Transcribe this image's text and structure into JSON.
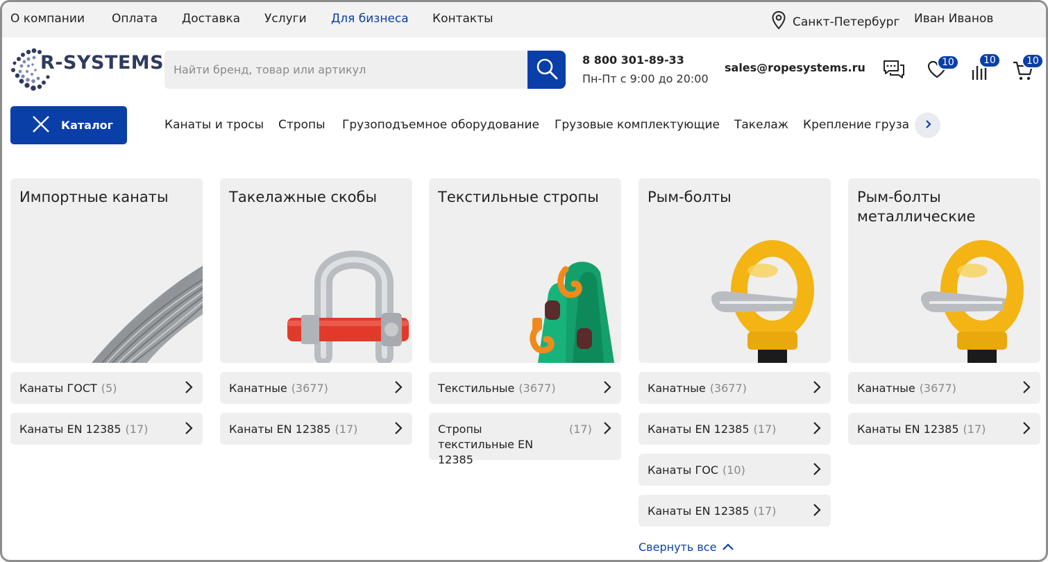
{
  "topbar": {
    "links": [
      "О компании",
      "Оплата",
      "Доставка",
      "Услуги",
      "Для бизнеса",
      "Контакты"
    ],
    "active_link": "Для бизнеса",
    "city": "Санкт-Петербург",
    "user": "Иван Иванов"
  },
  "header": {
    "logo_text": "R-SYSTEMS",
    "search_placeholder": "Найти бренд, товар или артикул",
    "phone": "8 800 301-89-33",
    "hours": "Пн-Пт с 9:00 до 20:00",
    "email": "sales@ropesystems.ru",
    "favorites_count": "10",
    "compare_count": "10",
    "cart_count": "10"
  },
  "catalog": {
    "button_label": "Каталог",
    "categories": [
      "Канаты и тросы",
      "Стропы",
      "Грузоподъемное оборудование",
      "Грузовые комплектующие",
      "Такелаж",
      "Крепление груза"
    ]
  },
  "cards": [
    {
      "title": "Импортные канаты",
      "image": "wire-rope",
      "items": [
        {
          "label": "Канаты ГОСТ",
          "count": "(5)"
        },
        {
          "label": "Канаты EN 12385",
          "count": "(17)"
        }
      ]
    },
    {
      "title": "Такелажные скобы",
      "image": "shackle",
      "items": [
        {
          "label": "Канатные",
          "count": "(3677)"
        },
        {
          "label": "Канаты EN 12385",
          "count": "(17)"
        }
      ]
    },
    {
      "title": "Текстильные стропы",
      "image": "textile-sling",
      "items": [
        {
          "label": "Текстильные",
          "count": "(3677)"
        },
        {
          "label": "Стропы текстильные EN 12385",
          "count": "(17)"
        }
      ]
    },
    {
      "title": "Рым-болты",
      "image": "eye-bolt",
      "items": [
        {
          "label": "Канатные",
          "count": "(3677)"
        },
        {
          "label": "Канаты EN 12385",
          "count": "(17)"
        },
        {
          "label": "Канаты ГОС",
          "count": "(10)"
        },
        {
          "label": "Канаты EN 12385",
          "count": "(17)"
        }
      ]
    },
    {
      "title": "Рым-болты металлические",
      "image": "eye-bolt",
      "items": [
        {
          "label": "Канатные",
          "count": "(3677)"
        },
        {
          "label": "Канаты EN 12385",
          "count": "(17)"
        }
      ]
    }
  ],
  "collapse_label": "Свернуть все",
  "colors": {
    "accent": "#0a3fa8",
    "card_bg": "#efefef",
    "topbar_bg": "#f2f2f2"
  }
}
